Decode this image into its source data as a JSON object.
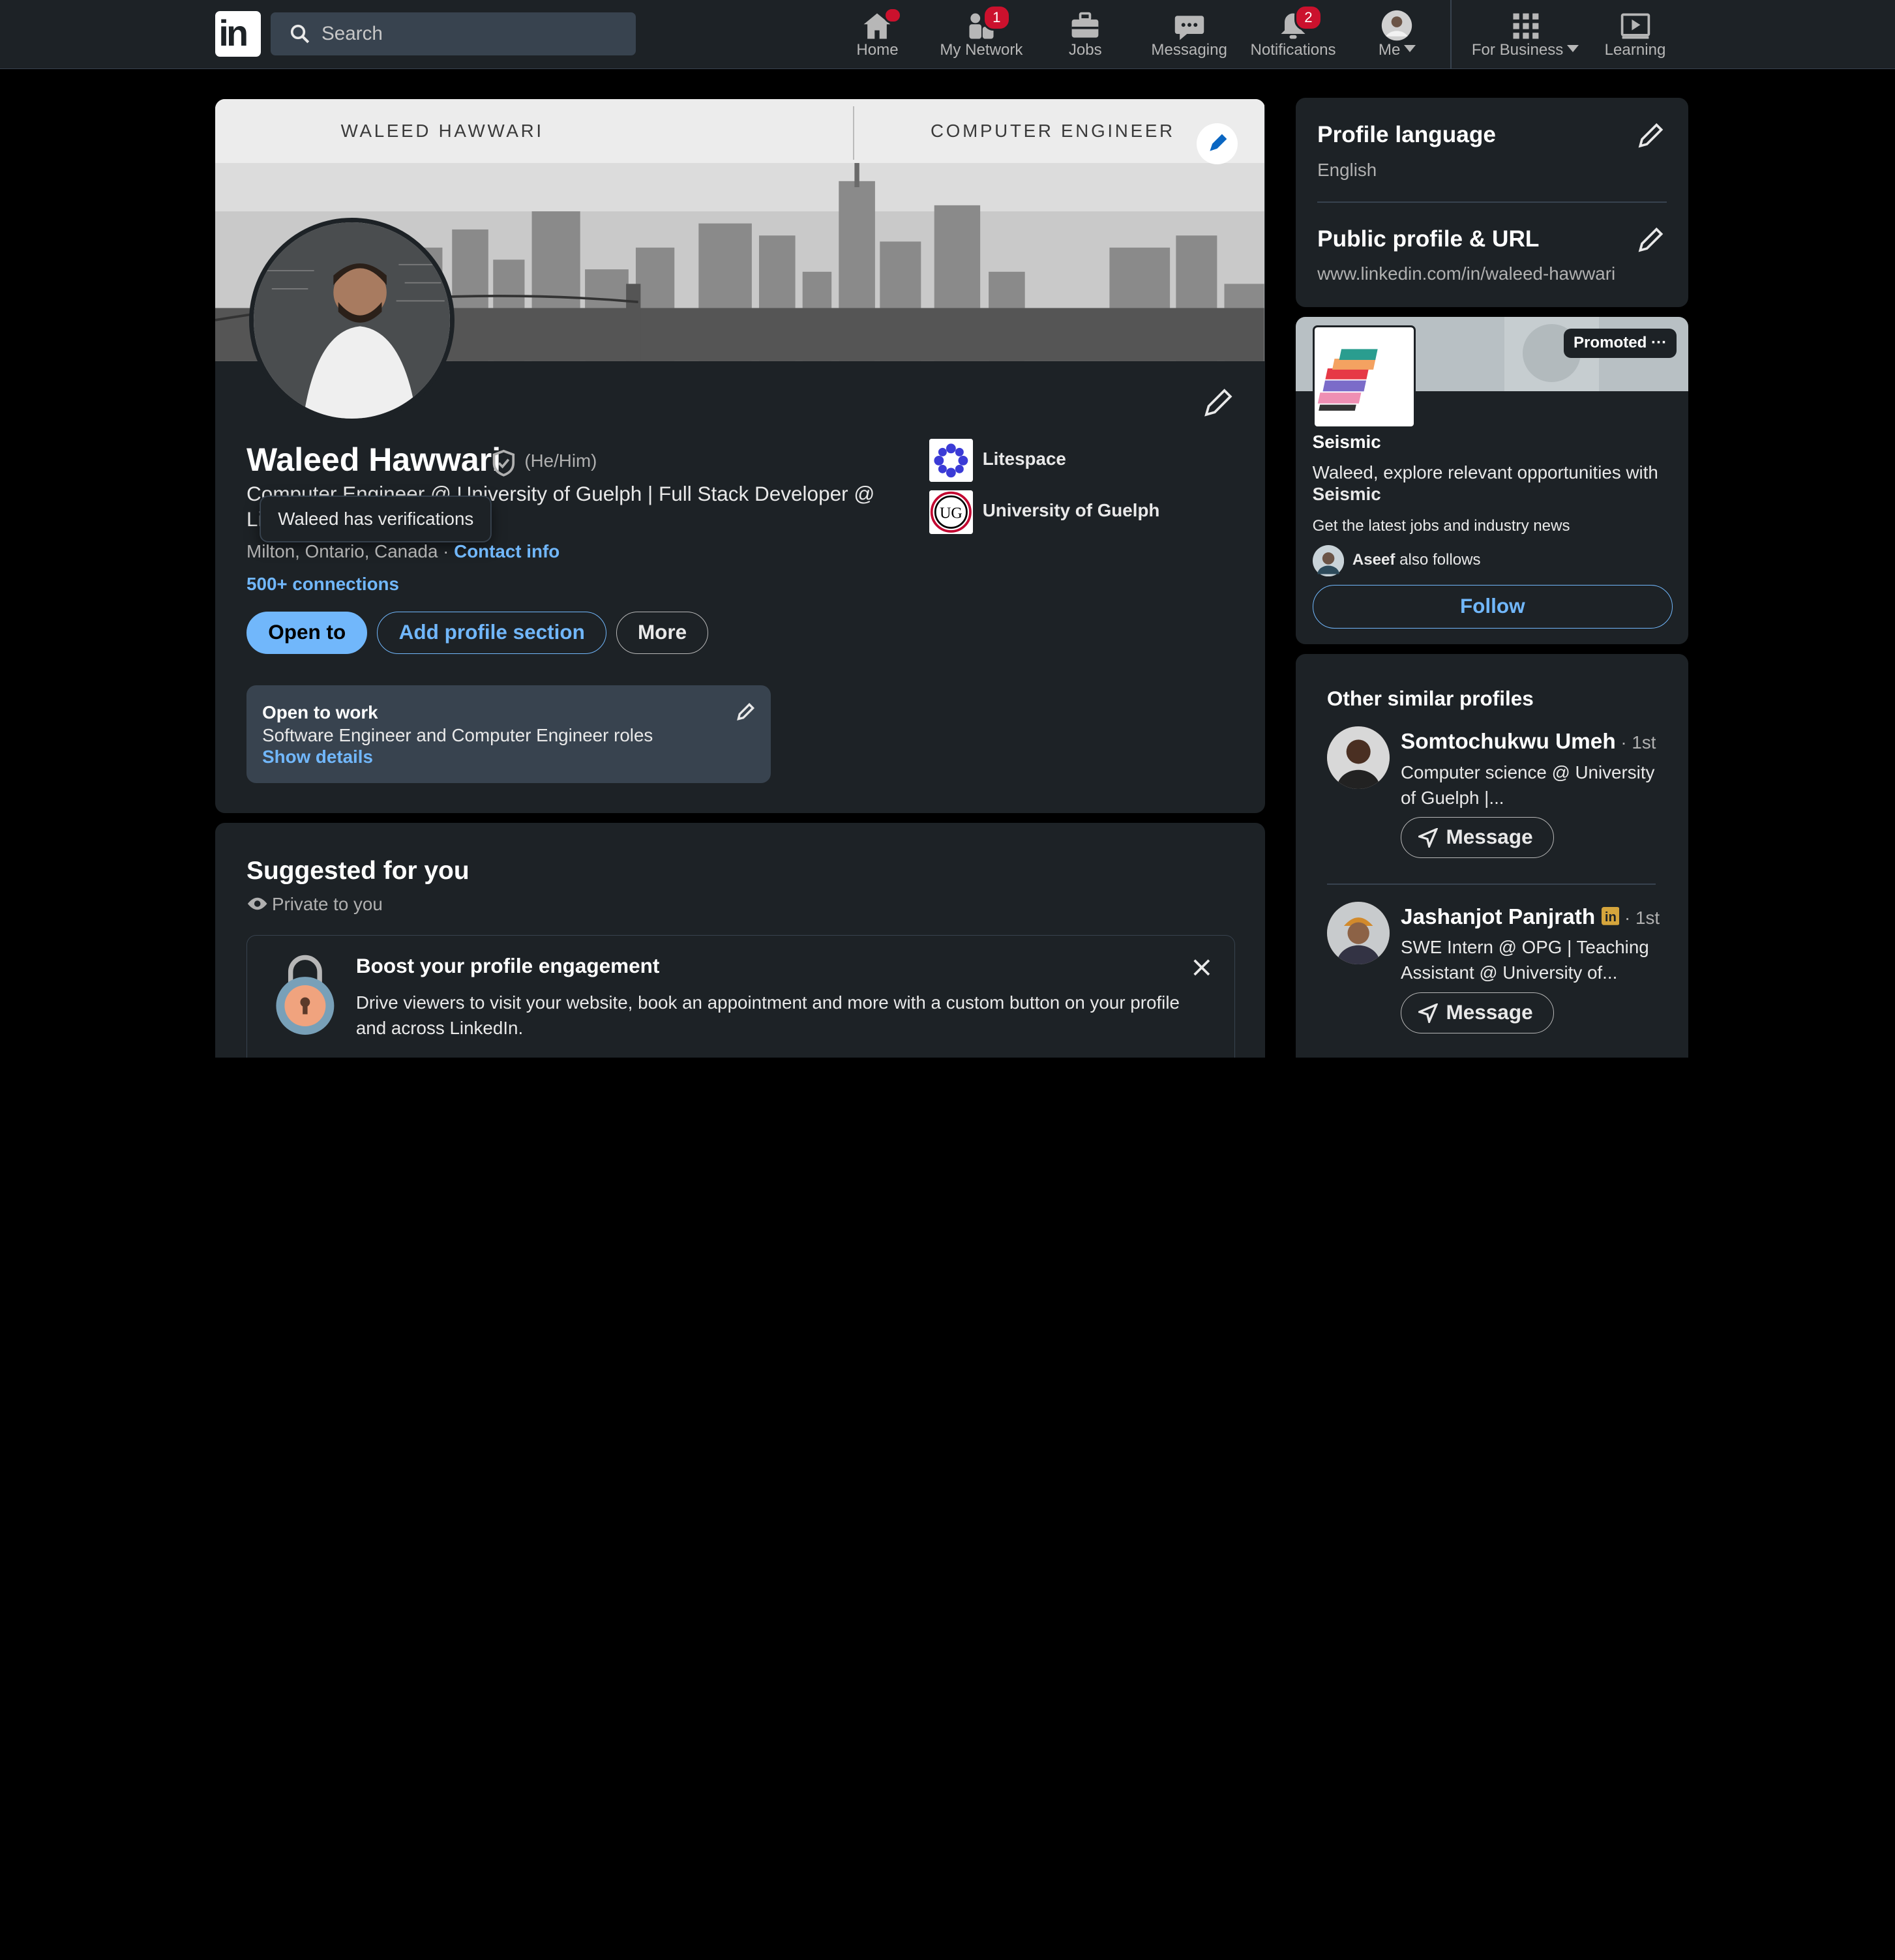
{
  "nav": {
    "logo": "in",
    "search_placeholder": "Search",
    "items": [
      {
        "label": "Home",
        "icon": "home-icon",
        "badge": ""
      },
      {
        "label": "My Network",
        "icon": "network-icon",
        "badge": "1"
      },
      {
        "label": "Jobs",
        "icon": "briefcase-icon",
        "badge": ""
      },
      {
        "label": "Messaging",
        "icon": "messaging-icon",
        "badge": ""
      },
      {
        "label": "Notifications",
        "icon": "bell-icon",
        "badge": "2"
      },
      {
        "label": "Me",
        "icon": "avatar",
        "badge": ""
      },
      {
        "label": "For Business",
        "icon": "grid-icon",
        "badge": ""
      },
      {
        "label": "Learning",
        "icon": "learning-icon",
        "badge": ""
      }
    ]
  },
  "profile": {
    "banner_left": "WALEED HAWWARI",
    "banner_right": "COMPUTER ENGINEER",
    "name": "Waleed Hawwari",
    "pronouns": "(He/Him)",
    "headline_line1": "Computer Engineer @ University of Guelph | Full Stack Developer @",
    "headline_line2": "Li",
    "tooltip": "Waleed has verifications",
    "location": "Milton, Ontario, Canada · ",
    "contact_info": "Contact info",
    "connections": "500+ connections",
    "buttons": {
      "open_to": "Open to",
      "add_section": "Add profile section",
      "more": "More"
    },
    "orgs": [
      {
        "name": "Litespace"
      },
      {
        "name": "University of Guelph"
      }
    ],
    "open_to_work": {
      "title": "Open to work",
      "roles": "Software Engineer and Computer Engineer roles",
      "link": "Show details"
    }
  },
  "suggested": {
    "title": "Suggested for you",
    "subtitle": "Private to you",
    "boost_title": "Boost your profile engagement",
    "boost_desc": "Drive viewers to visit your website, book an appointment and more with a custom button on your profile and across LinkedIn."
  },
  "sidebar": {
    "profile_language_title": "Profile language",
    "profile_language_value": "English",
    "public_profile_title": "Public profile & URL",
    "public_profile_url": "www.linkedin.com/in/waleed-hawwari"
  },
  "promo": {
    "tag": "Promoted",
    "company": "Seismic",
    "text_prefix": "Waleed, explore relevant opportunities with ",
    "text_company": "Seismic",
    "subtext": "Get the latest jobs and industry news",
    "follower_name": "Aseef",
    "follower_suffix": " also follows",
    "follow_label": "Follow"
  },
  "similar": {
    "title": "Other similar profiles",
    "people": [
      {
        "name": "Somtochukwu Umeh",
        "degree": " · 1st",
        "headline": "Computer science @ University of Guelph |...",
        "button": "Message"
      },
      {
        "name": "Jashanjot Panjrath",
        "degree": " · 1st",
        "headline": "SWE Intern @ OPG | Teaching Assistant @ University of...",
        "button": "Message"
      }
    ]
  },
  "colors": {
    "background": "#000000",
    "card": "#1d2226",
    "link": "#71b7fb",
    "badge": "#cb112d"
  }
}
